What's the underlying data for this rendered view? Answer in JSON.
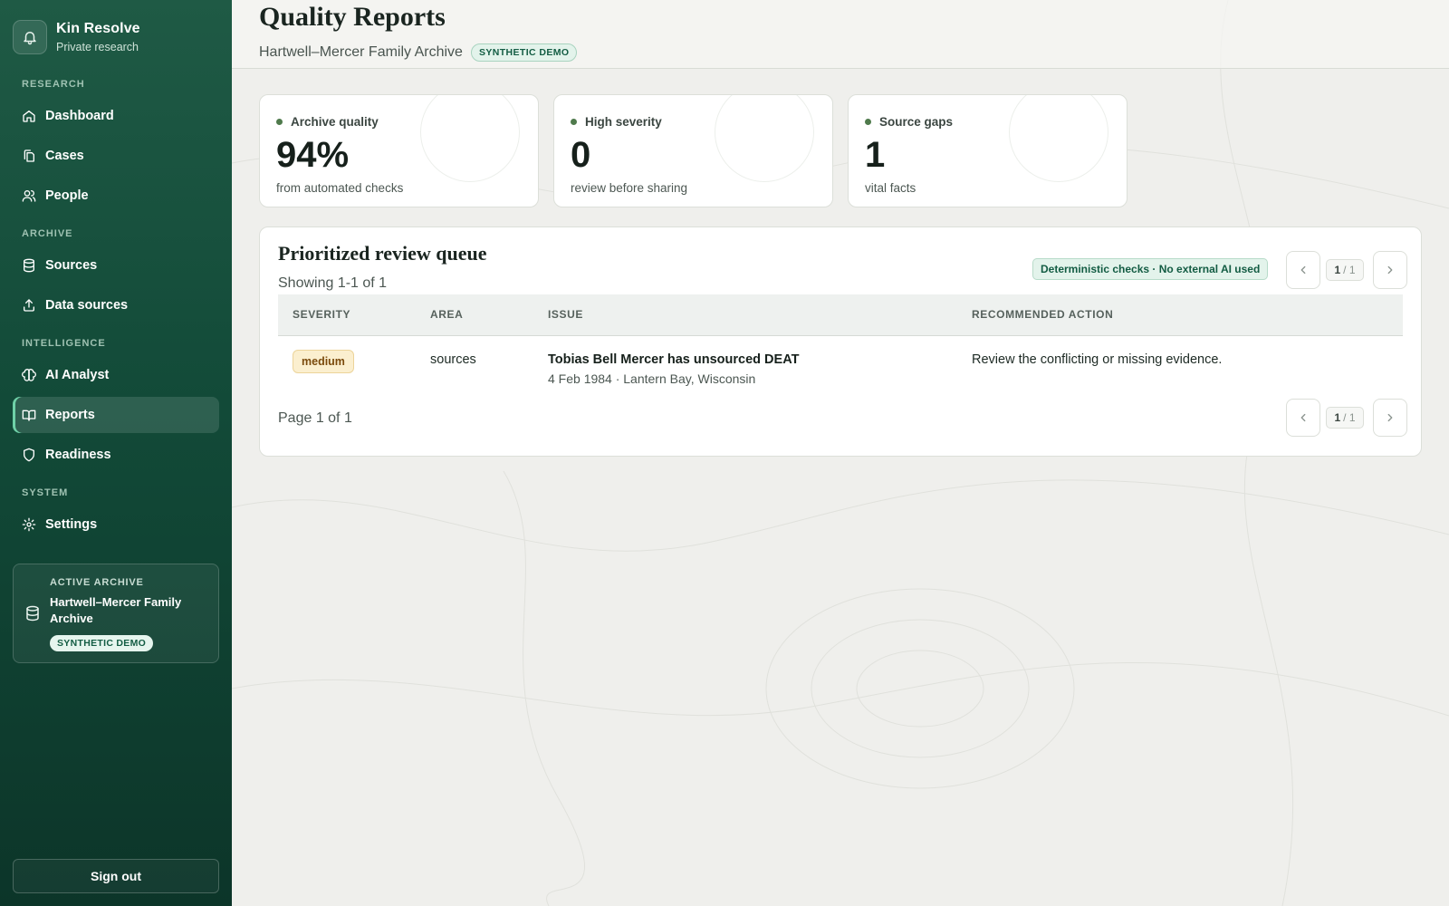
{
  "sidebar": {
    "brand": {
      "name": "Kin Resolve",
      "subtitle": "Private research"
    },
    "sections": {
      "research": "RESEARCH",
      "archive": "ARCHIVE",
      "intelligence": "INTELLIGENCE",
      "system": "SYSTEM"
    },
    "items": {
      "dashboard": "Dashboard",
      "cases": "Cases",
      "people": "People",
      "sources": "Sources",
      "data_sources": "Data sources",
      "ai_analyst": "AI Analyst",
      "reports": "Reports",
      "readiness": "Readiness",
      "settings": "Settings"
    },
    "active_item": "reports",
    "active_archive": {
      "label": "ACTIVE ARCHIVE",
      "name": "Hartwell–Mercer Family Archive",
      "badge": "SYNTHETIC DEMO"
    },
    "sign_out": "Sign out"
  },
  "header": {
    "title": "Quality Reports",
    "archive_name": "Hartwell–Mercer Family Archive",
    "badge": "SYNTHETIC DEMO"
  },
  "stats": [
    {
      "label": "Archive quality",
      "value": "94%",
      "desc": "from automated checks"
    },
    {
      "label": "High severity",
      "value": "0",
      "desc": "review before sharing"
    },
    {
      "label": "Source gaps",
      "value": "1",
      "desc": "vital facts"
    }
  ],
  "queue": {
    "title": "Prioritized review queue",
    "showing": "Showing 1-1 of 1",
    "badge": "Deterministic checks · No external AI used",
    "pager": {
      "current": "1",
      "total": "/ 1"
    },
    "columns": {
      "severity": "SEVERITY",
      "area": "AREA",
      "issue": "ISSUE",
      "action": "RECOMMENDED ACTION"
    },
    "rows": [
      {
        "severity": "medium",
        "area": "sources",
        "issue_title": "Tobias Bell Mercer has unsourced DEAT",
        "issue_detail": "4 Feb 1984 · Lantern Bay, Wisconsin",
        "action": "Review the conflicting or missing evidence."
      }
    ],
    "page_label": "Page 1 of 1"
  },
  "colors": {
    "sidebar_top": "#1f5a45",
    "sidebar_bottom": "#0c3529",
    "accent": "#135c43",
    "severity_medium_bg": "#fbefcf",
    "severity_medium_text": "#7a4a0c"
  }
}
